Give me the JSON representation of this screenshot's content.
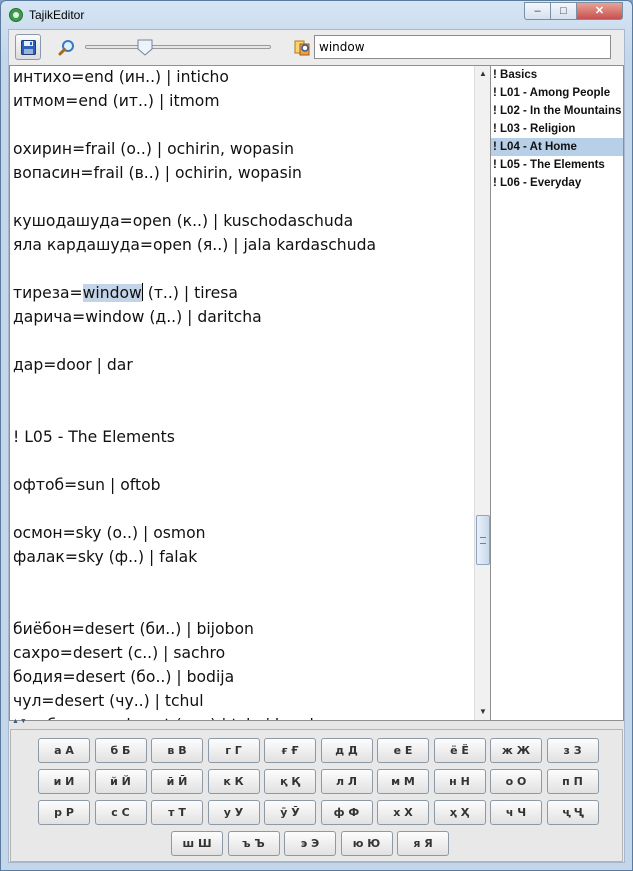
{
  "window": {
    "title": "TajikEditor",
    "controls": {
      "minimize": "–",
      "maximize": "□",
      "close": "✕"
    }
  },
  "toolbar": {
    "search_value": "window"
  },
  "editor": {
    "lines": [
      "интихо=end (ин..) | inticho",
      "итмом=end (ит..) | itmom",
      "",
      "охирин=frail (о..) | ochirin, wopasin",
      "вопасин=frail (в..) | ochirin, wopasin",
      "",
      "кушодашуда=open (к..) | kuschodaschuda",
      "яла кардашуда=open (я..) | jala kardaschuda",
      "",
      {
        "before": "тиреза=",
        "highlight": "window",
        "after": " (т..) | tiresa"
      },
      "дарича=window (д..) | daritcha",
      "",
      "дар=door | dar",
      "",
      "",
      "! L05 - The Elements",
      "",
      "офтоб=sun | oftob",
      "",
      "осмон=sky (о..) | osmon",
      "фалак=sky (ф..) | falak",
      "",
      "",
      "биёбон=desert (би..) | bijobon",
      "сахро=desert (с..) | sachro",
      "бодия=desert (бо..) | bodija",
      "чул=desert (чу..) | tchul",
      "чои беодам=desert (чо..) | tchoi beodam"
    ]
  },
  "outline": {
    "items": [
      "! Basics",
      "! L01 - Among People",
      "! L02 - In the Mountains",
      "! L03 - Religion",
      "! L04 - At Home",
      "! L05 - The Elements",
      "! L06 - Everyday"
    ],
    "selected_index": 4
  },
  "keyboard": {
    "rows": [
      [
        "а А",
        "б Б",
        "в В",
        "г Г",
        "ғ Ғ",
        "д Д",
        "е Е",
        "ё Ё",
        "ж Ж",
        "з З"
      ],
      [
        "и И",
        "й Й",
        "ӣ Ӣ",
        "к К",
        "қ Қ",
        "л Л",
        "м М",
        "н Н",
        "о О",
        "п П"
      ],
      [
        "р Р",
        "с С",
        "т Т",
        "у У",
        "ӯ Ӯ",
        "ф Ф",
        "х Х",
        "ҳ Ҳ",
        "ч Ч",
        "ҷ Ҷ"
      ],
      [
        "ш Ш",
        "ъ Ъ",
        "э Э",
        "ю Ю",
        "я Я"
      ]
    ]
  },
  "colors": {
    "selection": "#c3d4e8",
    "outline_selected": "#b8cfe8",
    "accent": "#3a9e48"
  },
  "icons": {
    "app": "app-icon",
    "save": "save-disk-icon",
    "zoom": "magnifier-icon",
    "find": "find-replace-icon"
  }
}
